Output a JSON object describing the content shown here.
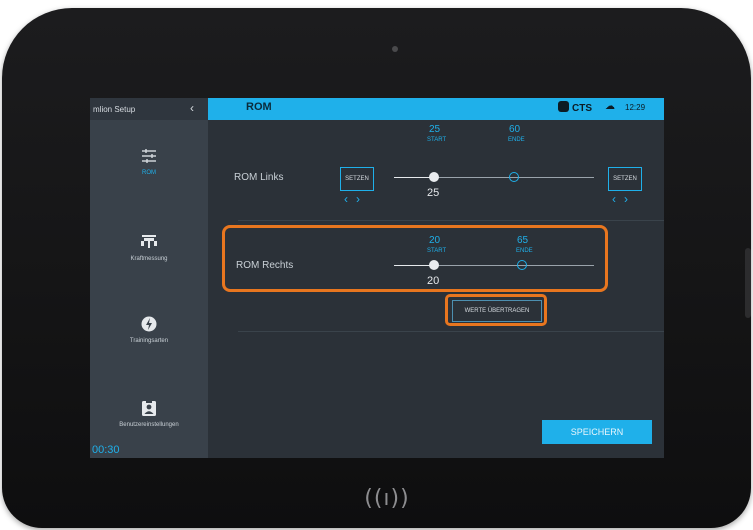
{
  "sidebar": {
    "header": "mlion Setup",
    "items": [
      {
        "label": "ROM",
        "icon": "sliders-icon"
      },
      {
        "label": "Kraftmessung",
        "icon": "fitness-machine-icon"
      },
      {
        "label": "Trainingsarten",
        "icon": "bolt-circle-icon"
      },
      {
        "label": "Benutzereinstellungen",
        "icon": "user-badge-icon"
      }
    ],
    "timer": "00:30"
  },
  "header": {
    "title": "ROM",
    "brand": "CTS",
    "time": "12:29"
  },
  "rom_links": {
    "label": "ROM Links",
    "set_left": "SETZEN",
    "set_right": "SETZEN",
    "start_value": "25",
    "start_label": "START",
    "end_value": "60",
    "end_label": "ENDE",
    "current": "25"
  },
  "rom_rechts": {
    "label": "ROM Rechts",
    "start_value": "20",
    "start_label": "START",
    "end_value": "65",
    "end_label": "ENDE",
    "current": "20"
  },
  "actions": {
    "transfer": "WERTE ÜBERTRAGEN",
    "save": "SPEICHERN"
  },
  "device": {
    "nfc_symbol": "((ı))"
  },
  "colors": {
    "accent": "#1fb0ea",
    "highlight": "#e8761f",
    "screen_bg": "#2b3138",
    "sidebar_bg": "#39414a"
  }
}
